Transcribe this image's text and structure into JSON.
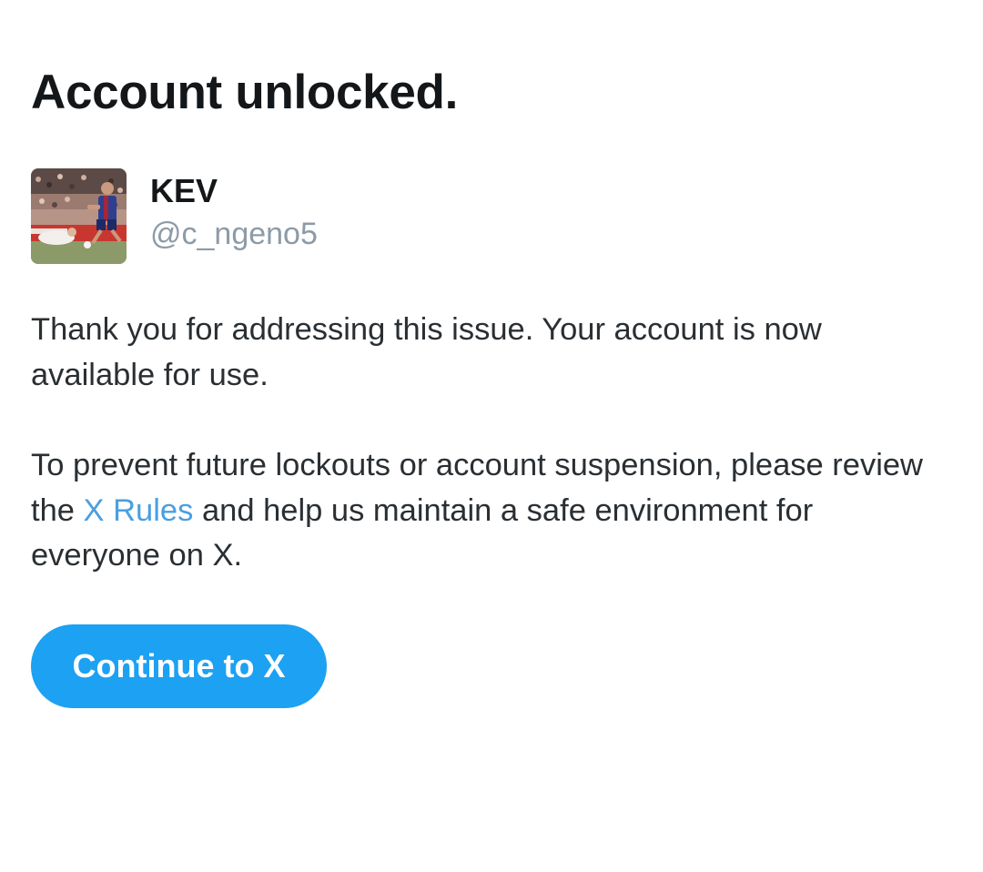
{
  "header": {
    "title": "Account unlocked."
  },
  "user": {
    "display_name": "KEV",
    "username": "@c_ngeno5",
    "avatar_icon": "profile-photo"
  },
  "message": {
    "paragraph_1": "Thank you for addressing this issue. Your account is now available for use.",
    "paragraph_2_before": "To prevent future lockouts or account suspension, please review the ",
    "paragraph_2_link": "X Rules",
    "paragraph_2_after": " and help us maintain a safe environment for everyone on X."
  },
  "actions": {
    "continue_label": "Continue to X"
  },
  "colors": {
    "accent": "#1da1f2",
    "link": "#4a9fe0",
    "secondary_text": "#8d9ba7",
    "primary_text": "#14171a"
  }
}
